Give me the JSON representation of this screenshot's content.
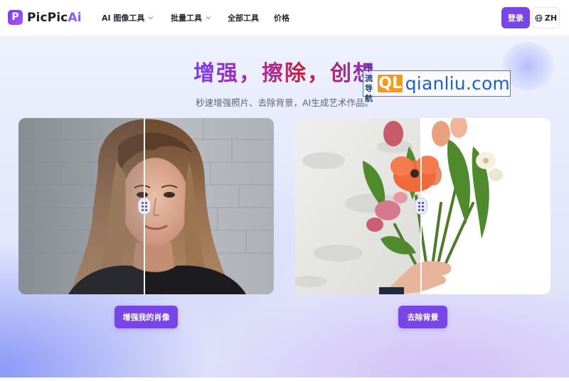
{
  "brand": {
    "name_prefix": "PicPic",
    "name_accent": "Ai",
    "logo_letter": "P"
  },
  "nav": {
    "items": [
      {
        "label": "AI 图像工具",
        "has_dropdown": true
      },
      {
        "label": "批量工具",
        "has_dropdown": true
      },
      {
        "label": "全部工具",
        "has_dropdown": false
      },
      {
        "label": "价格",
        "has_dropdown": false
      }
    ],
    "login_label": "登录",
    "language_label": "ZH"
  },
  "hero": {
    "title": "增强，擦除，创想",
    "subtitle": "秒速增强照片、去除背景，AI生成艺术作品。"
  },
  "showcase": {
    "portrait": {
      "button_label": "增强我的肖像",
      "compare_position": 0.49
    },
    "flower": {
      "button_label": "去除背景",
      "compare_position": 0.49
    }
  },
  "watermark": {
    "cn_line1": "千流",
    "cn_line2": "导航",
    "logo": "QL",
    "url": "qianliu.com"
  },
  "colors": {
    "accent": "#7a45e6",
    "title_gradient": [
      "#7c3aed",
      "#c0243a"
    ],
    "watermark_blue": "#1d63c0"
  },
  "icons": {
    "language": "globe-icon",
    "dropdown": "chevron-down-icon",
    "compare_handle": "drag-handle-icon"
  }
}
